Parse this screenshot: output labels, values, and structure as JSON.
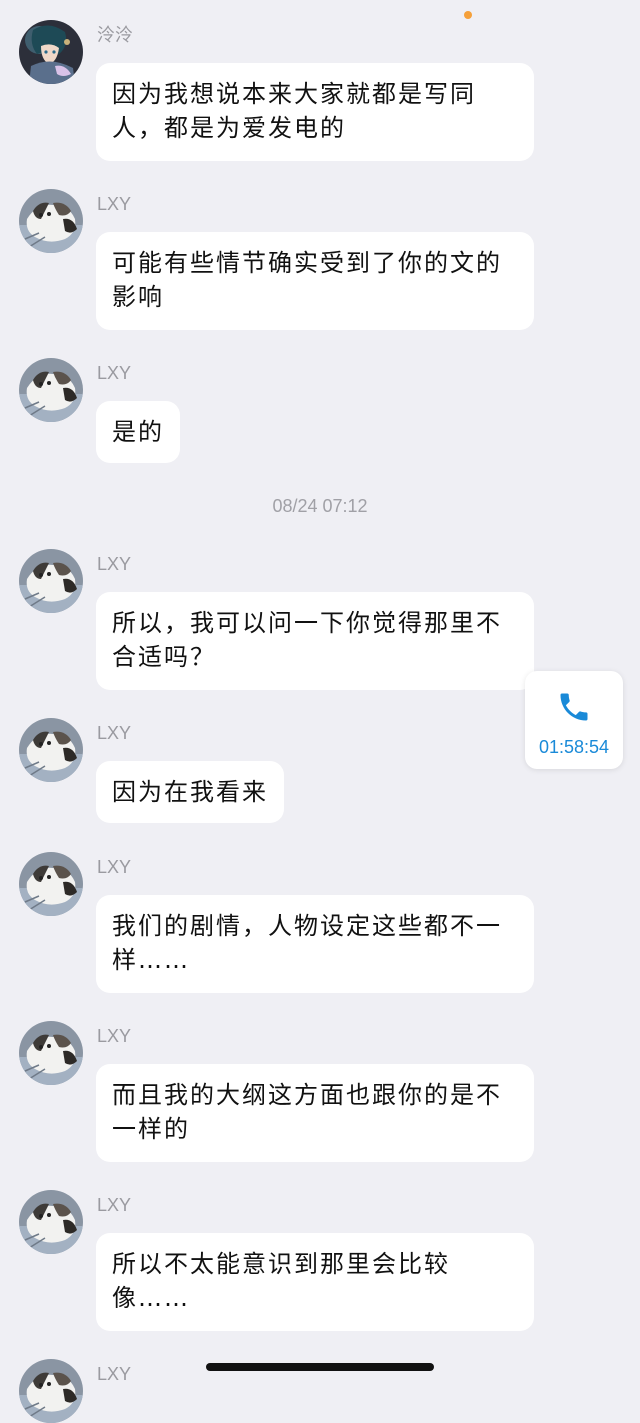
{
  "messages": [
    {
      "sender": "泠泠",
      "text": "因为我想说本来大家就都是写同人，都是为爱发电的",
      "avatar": "anime-character-avatar"
    },
    {
      "sender": "LXY",
      "text": "可能有些情节确实受到了你的文的影响",
      "avatar": "cat-avatar"
    },
    {
      "sender": "LXY",
      "text": "是的",
      "avatar": "cat-avatar"
    },
    {
      "sender": "LXY",
      "text": "所以，我可以问一下你觉得那里不合适吗？",
      "avatar": "cat-avatar"
    },
    {
      "sender": "LXY",
      "text": "因为在我看来",
      "avatar": "cat-avatar"
    },
    {
      "sender": "LXY",
      "text": "我们的剧情，人物设定这些都不一样……",
      "avatar": "cat-avatar"
    },
    {
      "sender": "LXY",
      "text": "而且我的大纲这方面也跟你的是不一样的",
      "avatar": "cat-avatar"
    },
    {
      "sender": "LXY",
      "text": "所以不太能意识到那里会比较像……",
      "avatar": "cat-avatar"
    },
    {
      "sender": "LXY",
      "text": "",
      "avatar": "cat-avatar"
    }
  ],
  "timestamp": "08/24 07:12",
  "call": {
    "duration": "01:58:54",
    "icon": "phone-icon",
    "color": "#1a8ad8"
  },
  "colors": {
    "background": "#efeff4",
    "bubble": "#ffffff",
    "status_dot": "#f5a03a"
  }
}
